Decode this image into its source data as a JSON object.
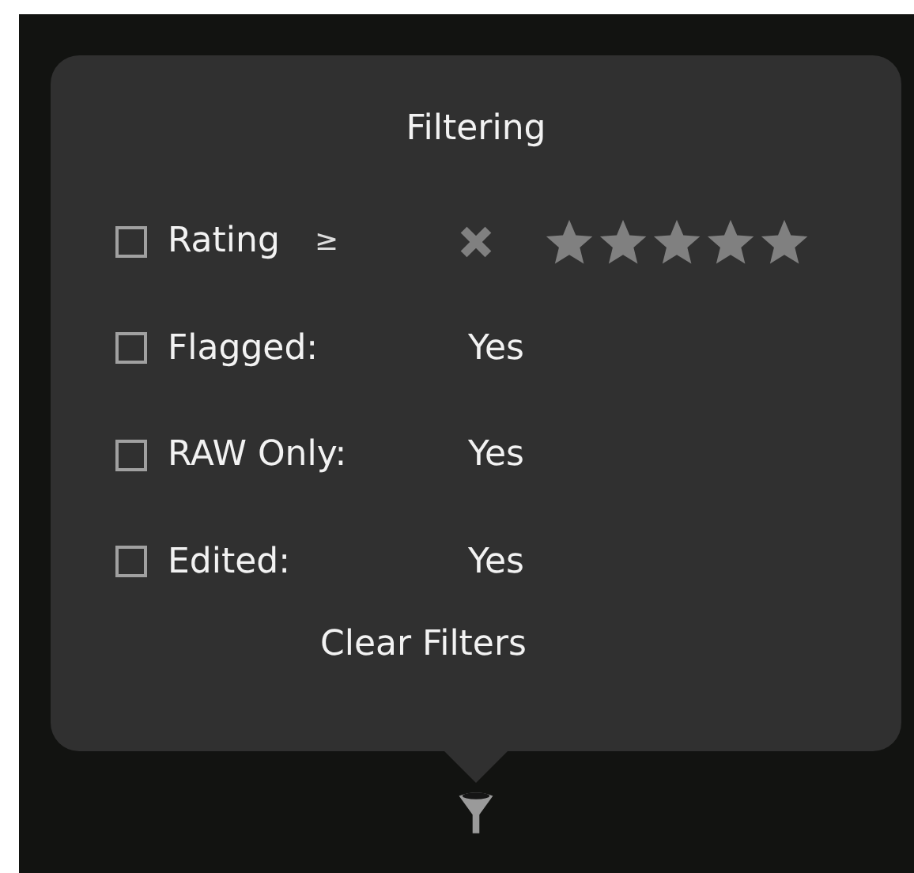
{
  "popover": {
    "title": "Filtering",
    "filters": [
      {
        "kind": "rating",
        "label": "Rating",
        "operator": "≥",
        "checked": false,
        "stars": 0
      },
      {
        "kind": "value",
        "label": "Flagged:",
        "value": "Yes",
        "checked": false
      },
      {
        "kind": "value",
        "label": "RAW Only:",
        "value": "Yes",
        "checked": false
      },
      {
        "kind": "value",
        "label": "Edited:",
        "value": "Yes",
        "checked": false
      }
    ],
    "clear_button": "Clear Filters"
  }
}
